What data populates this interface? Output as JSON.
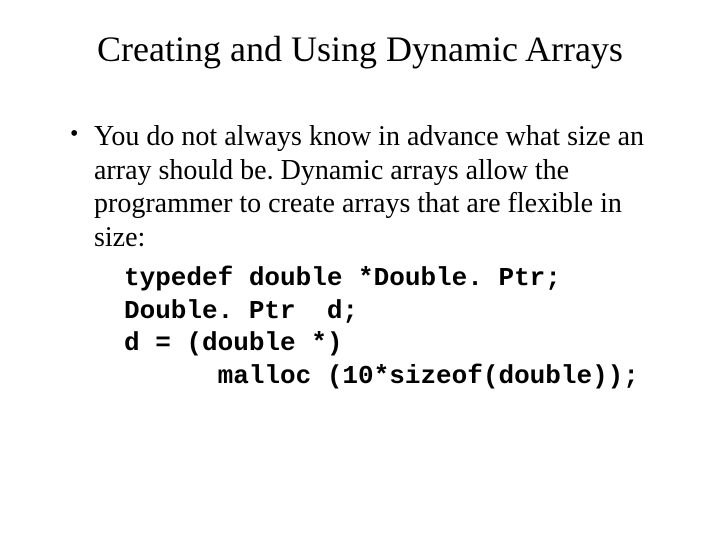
{
  "title": "Creating and Using Dynamic Arrays",
  "bullet": "You do not always know in advance what size an array should be.  Dynamic arrays allow the programmer to create arrays that are flexible in size:",
  "code": {
    "l1": "typedef double *Double. Ptr;",
    "l2": "Double. Ptr  d;",
    "l3": "d = (double *)",
    "l4": "      malloc (10*sizeof(double));"
  }
}
